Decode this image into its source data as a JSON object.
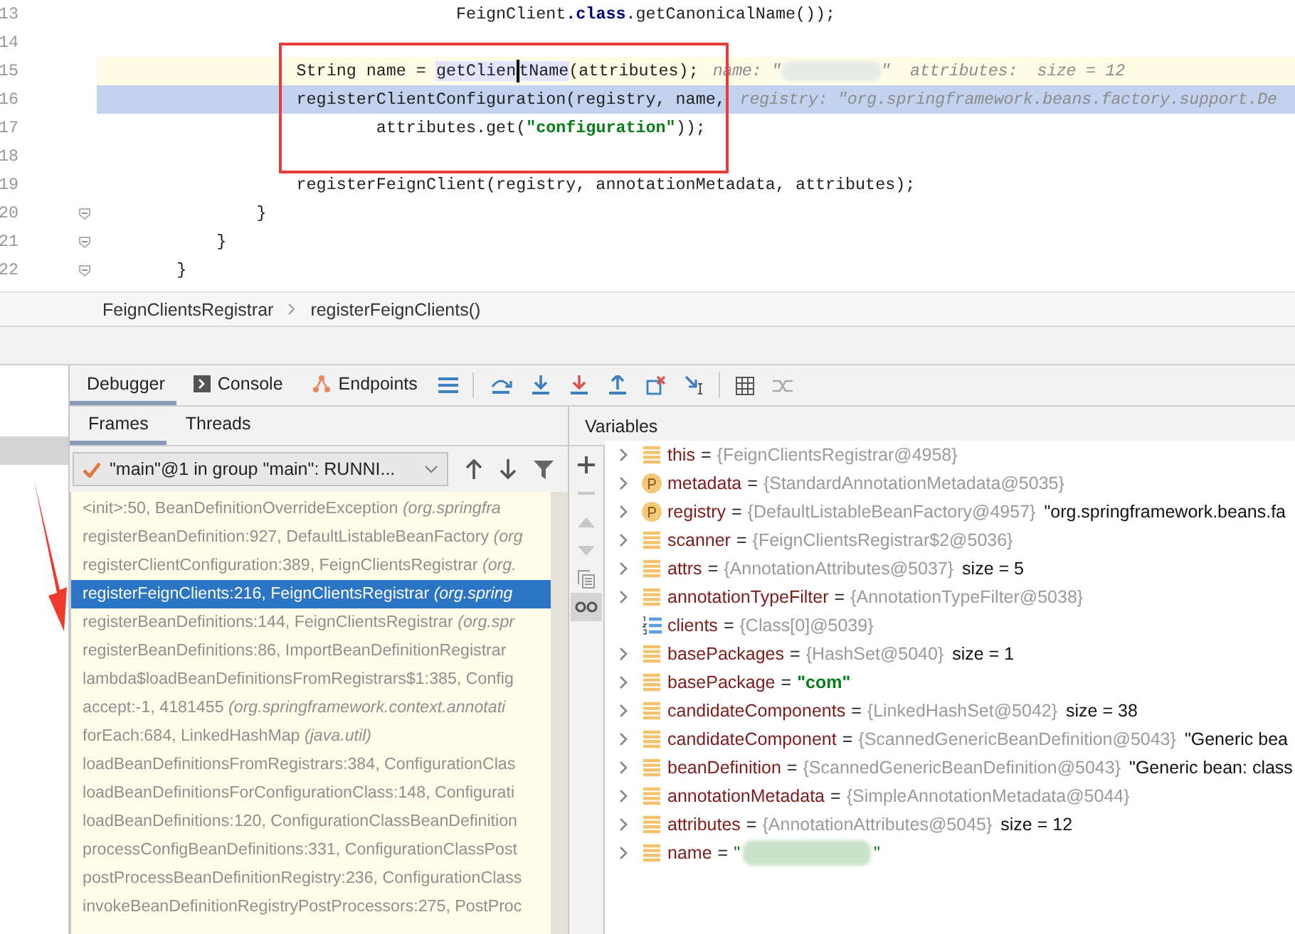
{
  "editor": {
    "lines": [
      {
        "number": "13",
        "kind": "plain",
        "segments": [
          {
            "text": "                                    FeignClient",
            "kind": "plain"
          },
          {
            "text": ".class",
            "kind": "keyword"
          },
          {
            "text": ".getCanonicalName());",
            "kind": "plain"
          }
        ]
      },
      {
        "number": "14",
        "kind": "plain"
      },
      {
        "number": "15",
        "kind": "caret-line",
        "segments": [
          {
            "text": "                    String name = ",
            "kind": "plain"
          },
          {
            "text": "getClien",
            "kind": "usage"
          },
          {
            "kind": "caret"
          },
          {
            "text": "tName",
            "kind": "usage"
          },
          {
            "text": "(attributes);",
            "kind": "plain"
          }
        ],
        "hints": [
          {
            "text": "name: \"",
            "kind": "hint"
          },
          {
            "kind": "redacted"
          },
          {
            "text": "\"  attributes:  size = 12",
            "kind": "hint"
          }
        ]
      },
      {
        "number": "16",
        "kind": "execution-line",
        "segments": [
          {
            "text": "                    registerClientConfiguration(registry, name,",
            "kind": "plain"
          }
        ],
        "hints": [
          {
            "text": "registry: \"org.springframework.beans.factory.support.De",
            "kind": "hint"
          }
        ]
      },
      {
        "number": "17",
        "kind": "plain",
        "segments": [
          {
            "text": "                            attributes.get(",
            "kind": "plain"
          },
          {
            "text": "\"configuration\"",
            "kind": "string"
          },
          {
            "text": "));",
            "kind": "plain"
          }
        ]
      },
      {
        "number": "18",
        "kind": "plain"
      },
      {
        "number": "19",
        "kind": "plain",
        "segments": [
          {
            "text": "                    registerFeignClient(registry, annotationMetadata, attributes);",
            "kind": "plain"
          }
        ]
      },
      {
        "number": "20",
        "kind": "plain",
        "fold": true,
        "segments": [
          {
            "text": "                }",
            "kind": "plain"
          }
        ]
      },
      {
        "number": "21",
        "kind": "plain",
        "fold": true,
        "segments": [
          {
            "text": "            }",
            "kind": "plain"
          }
        ]
      },
      {
        "number": "22",
        "kind": "plain",
        "fold": true,
        "segments": [
          {
            "text": "        }",
            "kind": "plain"
          }
        ]
      }
    ]
  },
  "breadcrumbs": [
    "FeignClientsRegistrar",
    "registerFeignClients()"
  ],
  "debug_tabs": [
    {
      "label": "Debugger",
      "kind": "plain",
      "selected": true
    },
    {
      "label": "Console",
      "kind": "console",
      "selected": false
    },
    {
      "label": "Endpoints",
      "kind": "endpoints",
      "selected": false
    }
  ],
  "frames_panel": {
    "tabs": [
      {
        "label": "Frames",
        "selected": true
      },
      {
        "label": "Threads",
        "selected": false
      }
    ],
    "thread_selector": "\"main\"@1 in group \"main\": RUNNI...",
    "frames": [
      {
        "text": "<init>:50, BeanDefinitionOverrideException",
        "package": "(org.springfra",
        "selected": false
      },
      {
        "text": "registerBeanDefinition:927, DefaultListableBeanFactory",
        "package": "(org",
        "selected": false
      },
      {
        "text": "registerClientConfiguration:389, FeignClientsRegistrar",
        "package": "(org.",
        "selected": false
      },
      {
        "text": "registerFeignClients:216, FeignClientsRegistrar",
        "package": "(org.spring",
        "selected": true
      },
      {
        "text": "registerBeanDefinitions:144, FeignClientsRegistrar",
        "package": "(org.spr",
        "selected": false
      },
      {
        "text": "registerBeanDefinitions:86, ImportBeanDefinitionRegistrar",
        "selected": false
      },
      {
        "text": "lambda$loadBeanDefinitionsFromRegistrars$1:385, Config",
        "selected": false
      },
      {
        "text": "accept:-1, 4181455",
        "package": "(org.springframework.context.annotati",
        "selected": false
      },
      {
        "text": "forEach:684, LinkedHashMap",
        "package": "(java.util)",
        "selected": false
      },
      {
        "text": "loadBeanDefinitionsFromRegistrars:384, ConfigurationClas",
        "selected": false
      },
      {
        "text": "loadBeanDefinitionsForConfigurationClass:148, Configurati",
        "selected": false
      },
      {
        "text": "loadBeanDefinitions:120, ConfigurationClassBeanDefinition",
        "selected": false
      },
      {
        "text": "processConfigBeanDefinitions:331, ConfigurationClassPost",
        "selected": false
      },
      {
        "text": "postProcessBeanDefinitionRegistry:236, ConfigurationClass",
        "selected": false
      },
      {
        "text": "invokeBeanDefinitionRegistryPostProcessors:275, PostProc",
        "selected": false
      }
    ]
  },
  "variables_panel": {
    "title": "Variables",
    "toolbar": [
      {
        "kind": "add",
        "disabled": false,
        "selected": false
      },
      {
        "kind": "remove",
        "disabled": true,
        "selected": false
      },
      {
        "kind": "up",
        "disabled": true,
        "selected": false
      },
      {
        "kind": "down",
        "disabled": true,
        "selected": false
      },
      {
        "kind": "copy",
        "disabled": false,
        "selected": false
      },
      {
        "kind": "watches",
        "disabled": false,
        "selected": true
      }
    ],
    "variables": [
      {
        "name": "this",
        "kind": "field",
        "expandable": true,
        "separator": "=",
        "value": {
          "kind": "object",
          "text": "{FeignClientsRegistrar@4958}"
        }
      },
      {
        "name": "metadata",
        "kind": "param",
        "expandable": true,
        "separator": "=",
        "value": {
          "kind": "object",
          "text": "{StandardAnnotationMetadata@5035}"
        }
      },
      {
        "name": "registry",
        "kind": "param",
        "expandable": true,
        "separator": "=",
        "value": {
          "kind": "object",
          "text": "{DefaultListableBeanFactory@4957}"
        },
        "extra": "\"org.springframework.beans.fa"
      },
      {
        "name": "scanner",
        "kind": "field",
        "expandable": true,
        "separator": "=",
        "value": {
          "kind": "object",
          "text": "{FeignClientsRegistrar$2@5036}"
        }
      },
      {
        "name": "attrs",
        "kind": "field",
        "expandable": true,
        "separator": "=",
        "value": {
          "kind": "object",
          "text": "{AnnotationAttributes@5037}"
        },
        "extra": "size = 5"
      },
      {
        "name": "annotationTypeFilter",
        "kind": "field",
        "expandable": true,
        "separator": "=",
        "value": {
          "kind": "object",
          "text": "{AnnotationTypeFilter@5038}"
        }
      },
      {
        "name": "clients",
        "kind": "array",
        "expandable": false,
        "separator": "=",
        "value": {
          "kind": "object",
          "text": "{Class[0]@5039}"
        }
      },
      {
        "name": "basePackages",
        "kind": "field",
        "expandable": true,
        "separator": "=",
        "value": {
          "kind": "object",
          "text": "{HashSet@5040}"
        },
        "extra": "size = 1"
      },
      {
        "name": "basePackage",
        "kind": "field",
        "expandable": true,
        "separator": "=",
        "value": {
          "kind": "string",
          "text": "\"com\""
        }
      },
      {
        "name": "candidateComponents",
        "kind": "field",
        "expandable": true,
        "separator": "=",
        "value": {
          "kind": "object",
          "text": "{LinkedHashSet@5042}"
        },
        "extra": "size = 38"
      },
      {
        "name": "candidateComponent",
        "kind": "field",
        "expandable": true,
        "separator": "=",
        "value": {
          "kind": "object",
          "text": "{ScannedGenericBeanDefinition@5043}"
        },
        "extra": "\"Generic bea"
      },
      {
        "name": "beanDefinition",
        "kind": "field",
        "expandable": true,
        "separator": "=",
        "value": {
          "kind": "object",
          "text": "{ScannedGenericBeanDefinition@5043}"
        },
        "extra": "\"Generic bean: class"
      },
      {
        "name": "annotationMetadata",
        "kind": "field",
        "expandable": true,
        "separator": "=",
        "value": {
          "kind": "object",
          "text": "{SimpleAnnotationMetadata@5044}"
        }
      },
      {
        "name": "attributes",
        "kind": "field",
        "expandable": true,
        "separator": "=",
        "value": {
          "kind": "object",
          "text": "{AnnotationAttributes@5045}"
        },
        "extra": "size = 12"
      },
      {
        "name": "name",
        "kind": "field",
        "expandable": true,
        "separator": "=",
        "value": {
          "kind": "redacted",
          "text": "\"",
          "end": "\""
        }
      }
    ]
  }
}
